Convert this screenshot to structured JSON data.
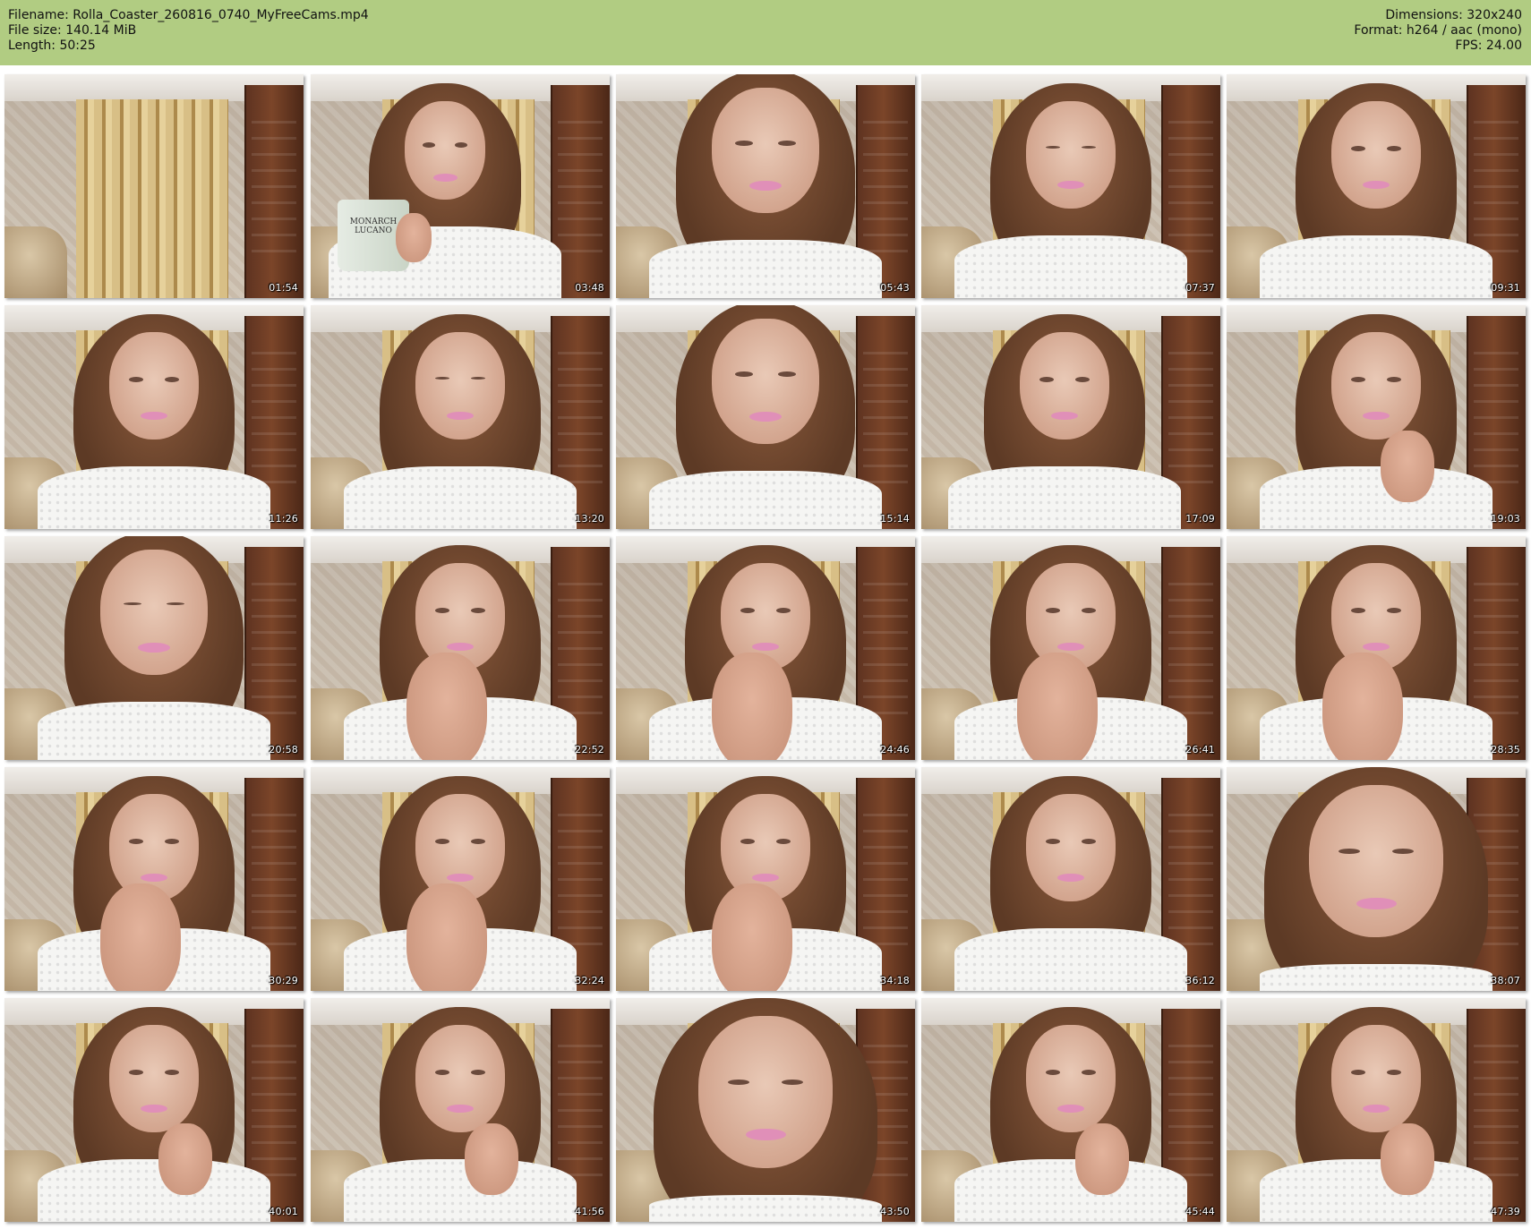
{
  "header": {
    "filename": "Filename: Rolla_Coaster_260816_0740_MyFreeCams.mp4",
    "filesize": "File size: 140.14 MiB",
    "length": "Length: 50:25",
    "dimensions": "Dimensions: 320x240",
    "format": "Format: h264 / aac (mono)",
    "fps": "FPS: 24.00"
  },
  "colors": {
    "header_bg": "#b1cc82",
    "page_bg": "#ffffff",
    "timestamp_text": "#ffffff"
  },
  "thumbnails": [
    {
      "timestamp": "01:54",
      "pose": "empty-room"
    },
    {
      "timestamp": "03:48",
      "pose": "holding-mug",
      "mug_text": "MONARCH LUCANO"
    },
    {
      "timestamp": "05:43",
      "pose": "close-smiling"
    },
    {
      "timestamp": "07:37",
      "pose": "looking-down"
    },
    {
      "timestamp": "09:31",
      "pose": "facing-camera"
    },
    {
      "timestamp": "11:26",
      "pose": "facing-camera"
    },
    {
      "timestamp": "13:20",
      "pose": "looking-down"
    },
    {
      "timestamp": "15:14",
      "pose": "close-smiling"
    },
    {
      "timestamp": "17:09",
      "pose": "head-tilted"
    },
    {
      "timestamp": "19:03",
      "pose": "hand-on-chin"
    },
    {
      "timestamp": "20:58",
      "pose": "close-looking-down"
    },
    {
      "timestamp": "22:52",
      "pose": "knee-up"
    },
    {
      "timestamp": "24:46",
      "pose": "knee-up"
    },
    {
      "timestamp": "26:41",
      "pose": "knee-up"
    },
    {
      "timestamp": "28:35",
      "pose": "knee-up"
    },
    {
      "timestamp": "30:29",
      "pose": "knee-up"
    },
    {
      "timestamp": "32:24",
      "pose": "knee-up"
    },
    {
      "timestamp": "34:18",
      "pose": "knee-up"
    },
    {
      "timestamp": "36:12",
      "pose": "facing-camera"
    },
    {
      "timestamp": "38:07",
      "pose": "very-close"
    },
    {
      "timestamp": "40:01",
      "pose": "hand-on-chin"
    },
    {
      "timestamp": "41:56",
      "pose": "hand-on-chin"
    },
    {
      "timestamp": "43:50",
      "pose": "very-close"
    },
    {
      "timestamp": "45:44",
      "pose": "hand-on-chin"
    },
    {
      "timestamp": "47:39",
      "pose": "hand-on-chin"
    }
  ]
}
